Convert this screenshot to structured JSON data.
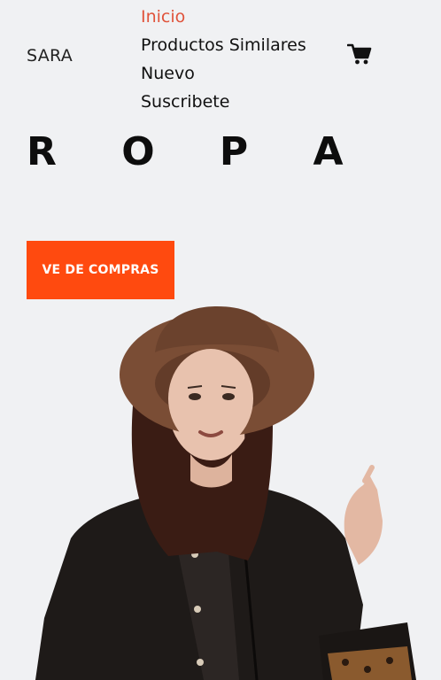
{
  "header": {
    "brand": "SARA",
    "nav": [
      {
        "label": "Inicio",
        "active": true
      },
      {
        "label": "Productos Similares",
        "active": false
      },
      {
        "label": "Nuevo",
        "active": false
      },
      {
        "label": "Suscribete",
        "active": false
      }
    ],
    "cart_icon": "shopping-cart-icon"
  },
  "hero": {
    "title": "R O P A",
    "cta_label": "VE DE COMPRAS",
    "image_alt": "model-photo"
  },
  "colors": {
    "background": "#f0f1f3",
    "accent": "#ff4a0f",
    "active_nav": "#e0533b",
    "text": "#111111"
  }
}
